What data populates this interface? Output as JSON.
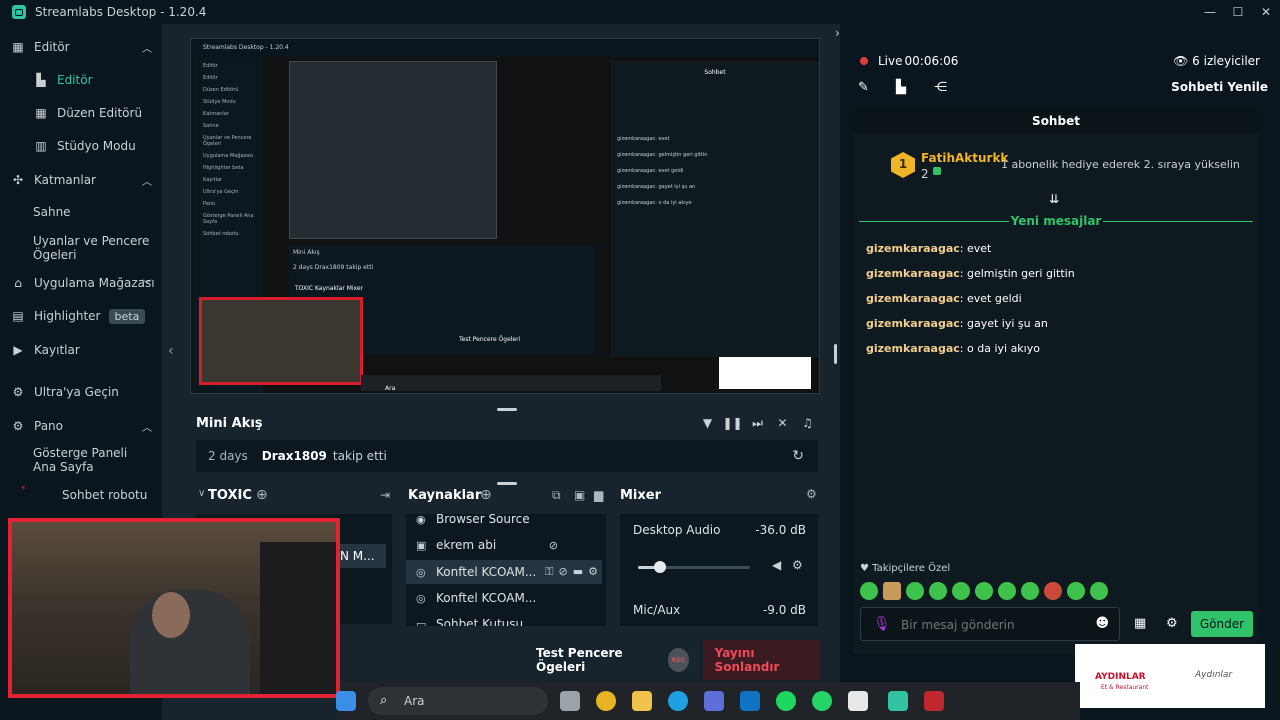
{
  "window": {
    "title": "Streamlabs Desktop - 1.20.4",
    "minimize": "—",
    "maximize": "☐",
    "close": "✕"
  },
  "sidebar": {
    "editor": "Editör",
    "editor_sub": [
      "Editör",
      "Düzen Editörü",
      "Stüdyo Modu"
    ],
    "layers": "Katmanlar",
    "layers_sub": [
      "Sahne",
      "Uyanlar ve Pencere Ögeleri"
    ],
    "app_store": "Uygulama Mağazası",
    "highlighter": "Highlighter",
    "highlighter_badge": "beta",
    "recordings": "Kayıtlar",
    "ultra": "Ultra'ya Geçin",
    "dashboard": "Pano",
    "dashboard_sub": [
      "Gösterge Paneli Ana Sayfa",
      "Sohbet robotu"
    ]
  },
  "preview": {
    "window_title": "Streamlabs Desktop - 1.20.4",
    "nav": [
      "Editör",
      "Editör",
      "Düzen Editörü",
      "Stüdyo Modu",
      "Katmanlar",
      "Sahne",
      "Uyanlar ve Pencere Ögeleri",
      "Uygulama Mağazası",
      "Highlighter beta",
      "Kayıtlar",
      "Ultra'ya Geçin",
      "Pano",
      "Gösterge Paneli Ana Sayfa",
      "Sohbet robotu"
    ],
    "mini_title": "Mini Akış",
    "mini_row": "2 days   Drax1809 takip etti",
    "docks": "TOXIC   Kaynaklar   Mixer",
    "chat_rows": [
      "gizemkaraagac: evet",
      "gizemkaraagac: gelmiştin geri gittin",
      "gizemkaraagac: evet geldi",
      "gizemkaraagac: gayet iyi şu an",
      "gizemkaraagac: o da iyi akıyo"
    ],
    "chat_header": "Sohbet",
    "test": "Test Pencere Ögeleri",
    "end": "Yayını Sonlandır",
    "search": "Ara"
  },
  "mini_feed": {
    "title": "Mini Akış",
    "event": {
      "time": "2 days",
      "user": "Drax1809",
      "action": "takip etti"
    }
  },
  "scenes": {
    "title": "TOXIC",
    "item": "N M..."
  },
  "sources": {
    "title": "Kaynaklar",
    "items": [
      "Browser Source",
      "ekrem abi",
      "Konftel KCOAM...",
      "Konftel KCOAM...",
      "Sohbet Kutusu"
    ]
  },
  "mixer": {
    "title": "Mixer",
    "channels": [
      {
        "name": "Desktop Audio",
        "db": "-36.0 dB",
        "level": 0.2
      },
      {
        "name": "Mic/Aux",
        "db": "-9.0 dB"
      }
    ]
  },
  "footer": {
    "test_label": "Test Pencere Ögeleri",
    "rec": "REC",
    "end_stream": "Yayını Sonlandır"
  },
  "chat": {
    "live_label": "Live",
    "timer": "00:06:06",
    "viewers": "6 izleyiciler",
    "refresh": "Sohbeti Yenile",
    "header": "Sohbet",
    "gift": {
      "user": "FatihAkturkk",
      "level": "1",
      "count": "2",
      "message": "1 abonelik hediye ederek 2. sıraya yükselin"
    },
    "new_messages": "Yeni mesajlar",
    "messages": [
      {
        "user": "gizemkaraagac",
        "text": ": evet"
      },
      {
        "user": "gizemkaraagac",
        "text": ": gelmiştin geri gittin"
      },
      {
        "user": "gizemkaraagac",
        "text": ": evet geldi"
      },
      {
        "user": "gizemkaraagac",
        "text": ": gayet iyi şu an"
      },
      {
        "user": "gizemkaraagac",
        "text": ": o da iyi akıyo"
      }
    ],
    "followers_label": "Takipçilere Özel",
    "input_placeholder": "Bir mesaj gönderin",
    "send": "Gönder"
  },
  "sponsor": {
    "left": "AYDINLAR",
    "left_sub": "Et & Restaurant",
    "right": "Aydınlar"
  },
  "taskbar": {
    "search": "Ara"
  },
  "colors": {
    "accent": "#31c3a2",
    "live": "#e03c3c",
    "chat_green": "#31c36a",
    "username": "#f2cf8f",
    "end_btn": "#ef4a5a"
  }
}
